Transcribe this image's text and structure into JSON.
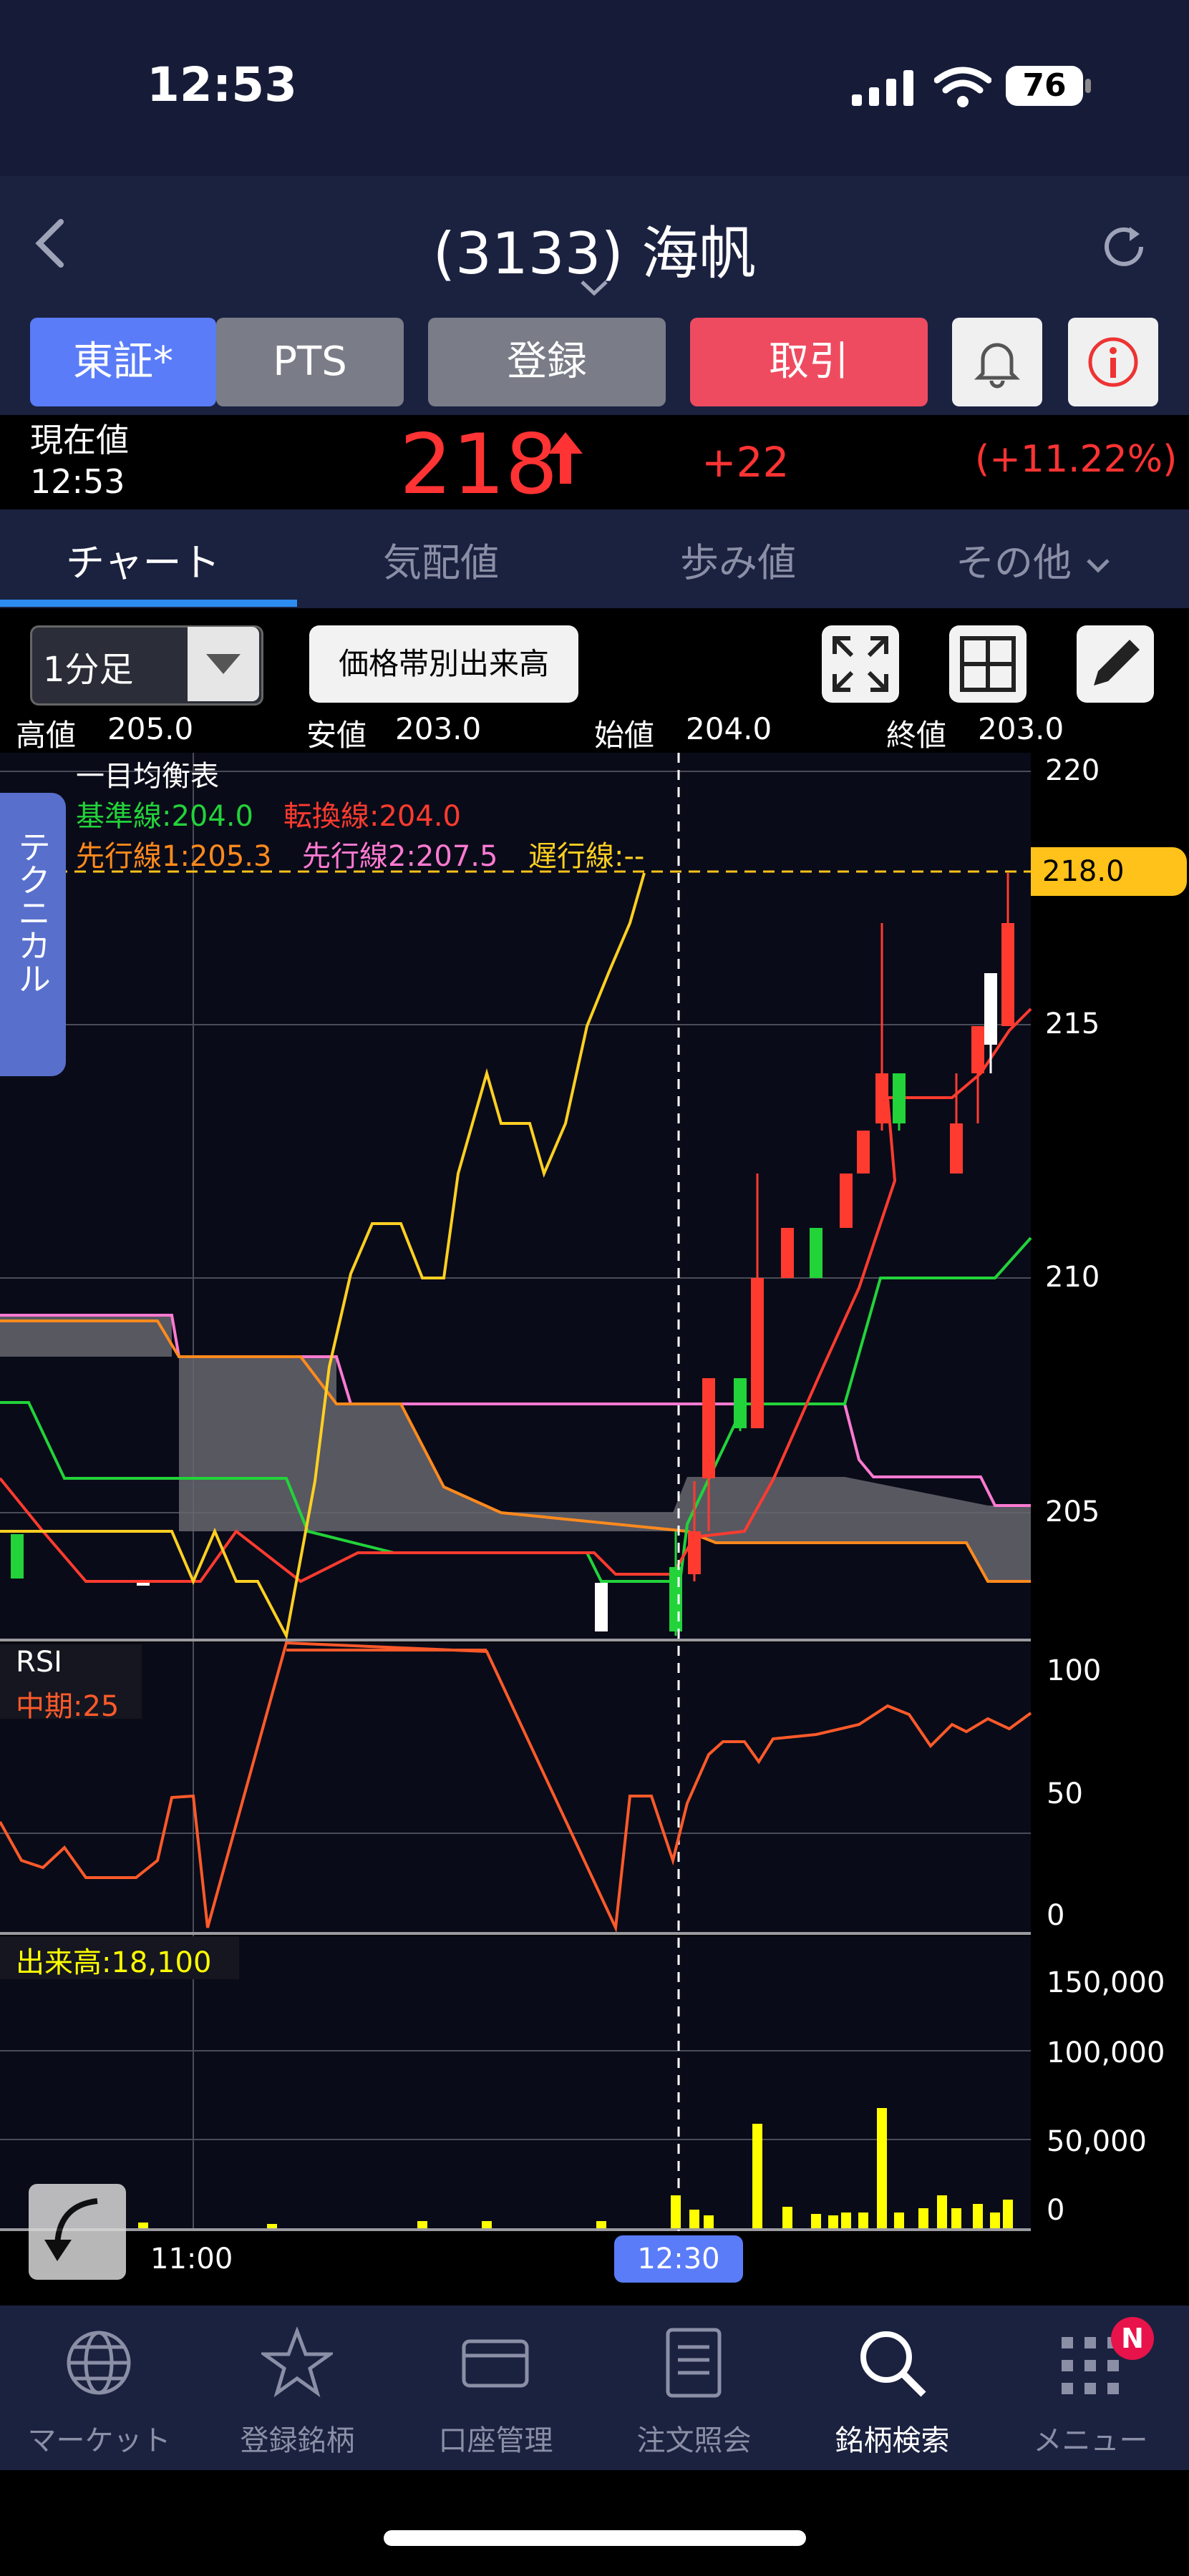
{
  "status": {
    "time": "12:53",
    "battery": "76"
  },
  "header": {
    "title": "(3133) 海帆"
  },
  "toolbar": {
    "exchange": "東証*",
    "pts": "PTS",
    "register": "登録",
    "trade": "取引"
  },
  "price": {
    "label": "現在値",
    "time": "12:53",
    "value": "218",
    "change": "+22",
    "pct": "(+11.22%)"
  },
  "tabs": [
    "チャート",
    "気配値",
    "歩み値",
    "その他"
  ],
  "controls": {
    "interval": "1分足",
    "volume_by_price": "価格帯別出来高"
  },
  "ohlc": {
    "high_label": "高値",
    "high": "205.0",
    "low_label": "安値",
    "low": "203.0",
    "open_label": "始値",
    "open": "204.0",
    "close_label": "終値",
    "close": "203.0"
  },
  "technical_tab": "テクニカル",
  "ichimoku": {
    "title": "一目均衡表",
    "kijun": "基準線:204.0",
    "tenkan": "転換線:204.0",
    "senko1": "先行線1:205.3",
    "senko2": "先行線2:207.5",
    "chikou": "遅行線:--"
  },
  "price_axis": [
    "220",
    "215",
    "210",
    "205"
  ],
  "current_price_tag": "218.0",
  "rsi": {
    "label": "RSI",
    "mid": "中期:25",
    "axis": [
      "100",
      "50",
      "0"
    ]
  },
  "volume": {
    "label": "出来高:18,100",
    "axis": [
      "150,000",
      "100,000",
      "50,000",
      "0"
    ]
  },
  "time_axis": {
    "t1": "11:00",
    "cursor": "12:30"
  },
  "nav": [
    "マーケット",
    "登録銘柄",
    "口座管理",
    "注文照会",
    "銘柄検索",
    "メニュー"
  ],
  "nav_badge": "N",
  "colors": {
    "up": "#ff3b2f",
    "down": "#22d33a",
    "kijun": "#22d33a",
    "tenkan": "#ff3b2f",
    "senko1": "#ff8a1d",
    "senko2": "#ff7ad2",
    "chikou": "#ffd021",
    "accent": "#5a7cf8",
    "volume": "#ffff00"
  }
}
